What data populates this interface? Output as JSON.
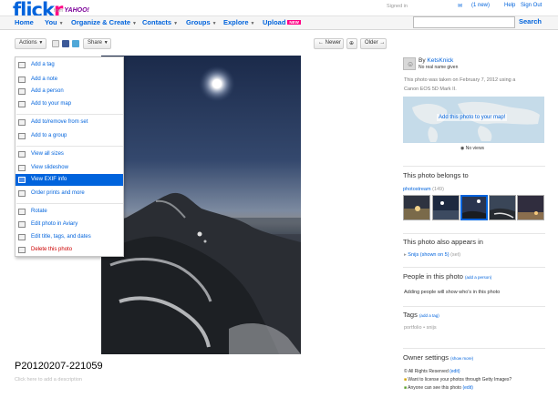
{
  "header": {
    "logo_left": "flick",
    "logo_right": "r",
    "from": "from",
    "yahoo": "YAHOO!",
    "signed_in": "Signed in",
    "new_count": "(1 new)",
    "help": "Help",
    "sign_out": "Sign Out",
    "search_label": "Search",
    "search_placeholder": "",
    "nav": {
      "home": "Home",
      "you": "You",
      "organize": "Organize & Create",
      "contacts": "Contacts",
      "groups": "Groups",
      "explore": "Explore",
      "upload": "Upload",
      "new_badge": "NEW"
    }
  },
  "toolbar": {
    "actions": "Actions",
    "share": "Share",
    "newer": "Newer",
    "older": "Older"
  },
  "menu": {
    "items": [
      {
        "label": "Add a tag",
        "icon": "tag-icon"
      },
      {
        "label": "Add a note",
        "icon": "note-icon"
      },
      {
        "label": "Add a person",
        "icon": "person-icon"
      },
      {
        "label": "Add to your map",
        "icon": "map-icon"
      },
      {
        "label": "Add to/remove from set",
        "icon": "set-icon"
      },
      {
        "label": "Add to a group",
        "icon": "group-icon"
      },
      {
        "label": "View all sizes",
        "icon": "sizes-icon"
      },
      {
        "label": "View slideshow",
        "icon": "slideshow-icon"
      },
      {
        "label": "View EXIF info",
        "icon": "exif-icon"
      },
      {
        "label": "Order prints and more",
        "icon": "prints-icon"
      },
      {
        "label": "Rotate",
        "icon": "rotate-icon"
      },
      {
        "label": "Edit photo in Aviary",
        "icon": "aviary-icon"
      },
      {
        "label": "Edit title, tags, and dates",
        "icon": "edit-icon"
      },
      {
        "label": "Delete this photo",
        "icon": "delete-icon"
      }
    ]
  },
  "photo": {
    "title": "P20120207-221059",
    "description_placeholder": "Click here to add a description"
  },
  "sidebar": {
    "by": "By",
    "owner": "KetsKnick",
    "owner_sub": "No real name given",
    "taken_line1": "This photo was taken on February 7, 2012 using a",
    "taken_line2": "Canon EOS 5D Mark II.",
    "map_button": "Add this photo to your map!",
    "views": "No views",
    "belongs_heading": "This photo belongs to",
    "photostream": "photostream",
    "photostream_count": "(149)",
    "appears_heading": "This photo also appears in",
    "set_name": "Snijs (shown on 5)",
    "set_edit": "(set)",
    "people_heading": "People in this photo",
    "add_person": "(add a person)",
    "people_text": "Adding people will show who's in this photo",
    "tags_heading": "Tags",
    "add_tag": "(add a tag)",
    "tags": [
      "portfolio",
      "snijs"
    ],
    "owner_settings": "Owner settings",
    "show_more": "(show more)",
    "rights": "All Rights Reserved",
    "rights_edit": "(edit)",
    "license": "Want to license your photos through Getty Images?",
    "visibility": "Anyone can see this photo",
    "visibility_edit": "(edit)"
  }
}
